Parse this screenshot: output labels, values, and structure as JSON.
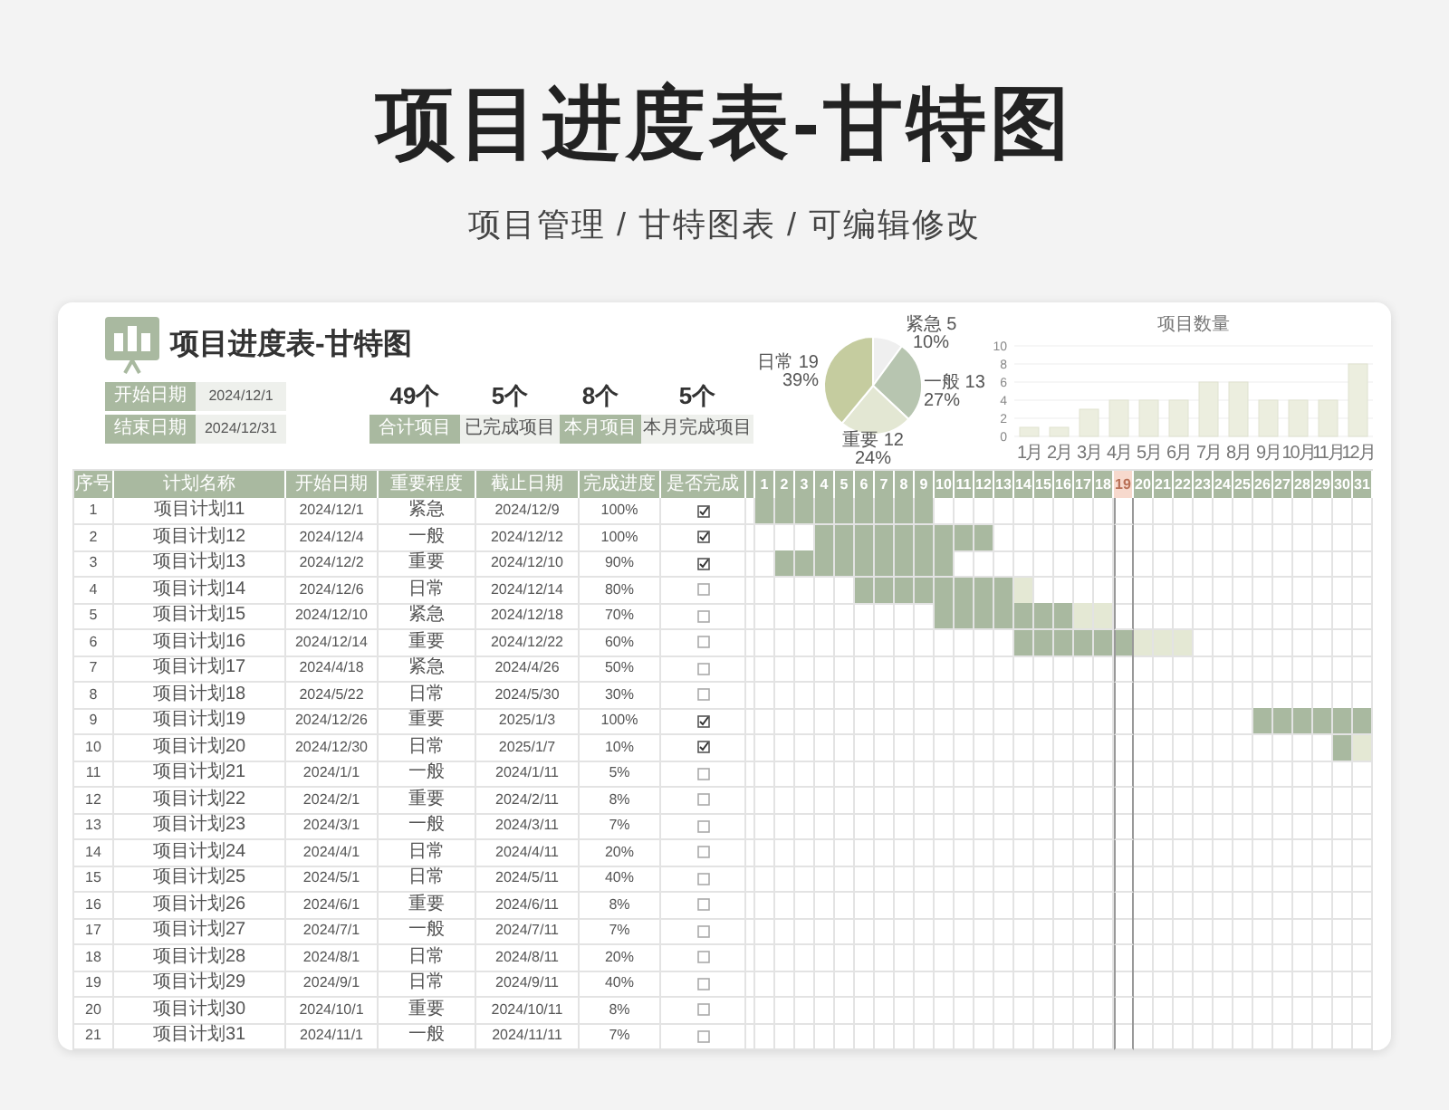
{
  "page_title": "项目进度表-甘特图",
  "subtitle": "项目管理 / 甘特图表 / 可编辑修改",
  "sheet_title": "项目进度表-甘特图",
  "info": [
    {
      "label": "开始日期",
      "value": "2024/12/1"
    },
    {
      "label": "结束日期",
      "value": "2024/12/31"
    }
  ],
  "stats": [
    {
      "value": "49个",
      "label": "合计项目",
      "accent": true
    },
    {
      "value": "5个",
      "label": "已完成项目",
      "accent": false
    },
    {
      "value": "8个",
      "label": "本月项目",
      "accent": true
    },
    {
      "value": "5个",
      "label": "本月完成项目",
      "accent": false
    }
  ],
  "pie": {
    "chart_data": {
      "type": "pie",
      "categories": [
        "紧急 5",
        "一般 13",
        "重要 12",
        "日常 19"
      ],
      "values": [
        10,
        27,
        24,
        39
      ],
      "colors": [
        "#efefef",
        "#b7c5b0",
        "#e3e7d3",
        "#c5cc9f"
      ],
      "data_labels": true,
      "value_labels": [
        "10%",
        "27%",
        "24%",
        "39%"
      ]
    }
  },
  "bar": {
    "chart_data": {
      "type": "bar",
      "title": "项目数量",
      "categories": [
        "1月",
        "2月",
        "3月",
        "4月",
        "5月",
        "6月",
        "7月",
        "8月",
        "9月",
        "10月",
        "11月",
        "12月"
      ],
      "series": [
        {
          "color": "#eceedf",
          "values": [
            1,
            1,
            3,
            4,
            4,
            4,
            6,
            6,
            4,
            4,
            4,
            8
          ]
        }
      ],
      "ylim": [
        0,
        10
      ],
      "yticks": [
        0,
        2,
        4,
        6,
        8,
        10
      ],
      "grid": true
    }
  },
  "table": {
    "columns": [
      "序号",
      "计划名称",
      "开始日期",
      "重要程度",
      "截止日期",
      "完成进度",
      "是否完成"
    ],
    "rows": [
      {
        "no": "1",
        "name": "项目计划11",
        "start": "2024/12/1",
        "priority": "紧急",
        "end": "2024/12/9",
        "progress": "100%",
        "done": true
      },
      {
        "no": "2",
        "name": "项目计划12",
        "start": "2024/12/4",
        "priority": "一般",
        "end": "2024/12/12",
        "progress": "100%",
        "done": true
      },
      {
        "no": "3",
        "name": "项目计划13",
        "start": "2024/12/2",
        "priority": "重要",
        "end": "2024/12/10",
        "progress": "90%",
        "done": true
      },
      {
        "no": "4",
        "name": "项目计划14",
        "start": "2024/12/6",
        "priority": "日常",
        "end": "2024/12/14",
        "progress": "80%",
        "done": false
      },
      {
        "no": "5",
        "name": "项目计划15",
        "start": "2024/12/10",
        "priority": "紧急",
        "end": "2024/12/18",
        "progress": "70%",
        "done": false
      },
      {
        "no": "6",
        "name": "项目计划16",
        "start": "2024/12/14",
        "priority": "重要",
        "end": "2024/12/22",
        "progress": "60%",
        "done": false
      },
      {
        "no": "7",
        "name": "项目计划17",
        "start": "2024/4/18",
        "priority": "紧急",
        "end": "2024/4/26",
        "progress": "50%",
        "done": false
      },
      {
        "no": "8",
        "name": "项目计划18",
        "start": "2024/5/22",
        "priority": "日常",
        "end": "2024/5/30",
        "progress": "30%",
        "done": false
      },
      {
        "no": "9",
        "name": "项目计划19",
        "start": "2024/12/26",
        "priority": "重要",
        "end": "2025/1/3",
        "progress": "100%",
        "done": true
      },
      {
        "no": "10",
        "name": "项目计划20",
        "start": "2024/12/30",
        "priority": "日常",
        "end": "2025/1/7",
        "progress": "10%",
        "done": true
      },
      {
        "no": "11",
        "name": "项目计划21",
        "start": "2024/1/1",
        "priority": "一般",
        "end": "2024/1/11",
        "progress": "5%",
        "done": false
      },
      {
        "no": "12",
        "name": "项目计划22",
        "start": "2024/2/1",
        "priority": "重要",
        "end": "2024/2/11",
        "progress": "8%",
        "done": false
      },
      {
        "no": "13",
        "name": "项目计划23",
        "start": "2024/3/1",
        "priority": "一般",
        "end": "2024/3/11",
        "progress": "7%",
        "done": false
      },
      {
        "no": "14",
        "name": "项目计划24",
        "start": "2024/4/1",
        "priority": "日常",
        "end": "2024/4/11",
        "progress": "20%",
        "done": false
      },
      {
        "no": "15",
        "name": "项目计划25",
        "start": "2024/5/1",
        "priority": "日常",
        "end": "2024/5/11",
        "progress": "40%",
        "done": false
      },
      {
        "no": "16",
        "name": "项目计划26",
        "start": "2024/6/1",
        "priority": "重要",
        "end": "2024/6/11",
        "progress": "8%",
        "done": false
      },
      {
        "no": "17",
        "name": "项目计划27",
        "start": "2024/7/1",
        "priority": "一般",
        "end": "2024/7/11",
        "progress": "7%",
        "done": false
      },
      {
        "no": "18",
        "name": "项目计划28",
        "start": "2024/8/1",
        "priority": "日常",
        "end": "2024/8/11",
        "progress": "20%",
        "done": false
      },
      {
        "no": "19",
        "name": "项目计划29",
        "start": "2024/9/1",
        "priority": "日常",
        "end": "2024/9/11",
        "progress": "40%",
        "done": false
      },
      {
        "no": "20",
        "name": "项目计划30",
        "start": "2024/10/1",
        "priority": "重要",
        "end": "2024/10/11",
        "progress": "8%",
        "done": false
      },
      {
        "no": "21",
        "name": "项目计划31",
        "start": "2024/11/1",
        "priority": "一般",
        "end": "2024/11/11",
        "progress": "7%",
        "done": false
      }
    ]
  },
  "gantt": {
    "days": [
      {
        "label": "1",
        "today": false
      },
      {
        "label": "2",
        "today": false
      },
      {
        "label": "3",
        "today": false
      },
      {
        "label": "4",
        "today": false
      },
      {
        "label": "5",
        "today": false
      },
      {
        "label": "6",
        "today": false
      },
      {
        "label": "7",
        "today": false
      },
      {
        "label": "8",
        "today": false
      },
      {
        "label": "9",
        "today": false
      },
      {
        "label": "10",
        "today": false
      },
      {
        "label": "11",
        "today": false
      },
      {
        "label": "12",
        "today": false
      },
      {
        "label": "13",
        "today": false
      },
      {
        "label": "14",
        "today": false
      },
      {
        "label": "15",
        "today": false
      },
      {
        "label": "16",
        "today": false
      },
      {
        "label": "17",
        "today": false
      },
      {
        "label": "18",
        "today": false
      },
      {
        "label": "19",
        "today": true
      },
      {
        "label": "20",
        "today": false
      },
      {
        "label": "21",
        "today": false
      },
      {
        "label": "22",
        "today": false
      },
      {
        "label": "23",
        "today": false
      },
      {
        "label": "24",
        "today": false
      },
      {
        "label": "25",
        "today": false
      },
      {
        "label": "26",
        "today": false
      },
      {
        "label": "27",
        "today": false
      },
      {
        "label": "28",
        "today": false
      },
      {
        "label": "29",
        "today": false
      },
      {
        "label": "30",
        "today": false
      },
      {
        "label": "31",
        "today": false
      }
    ]
  }
}
